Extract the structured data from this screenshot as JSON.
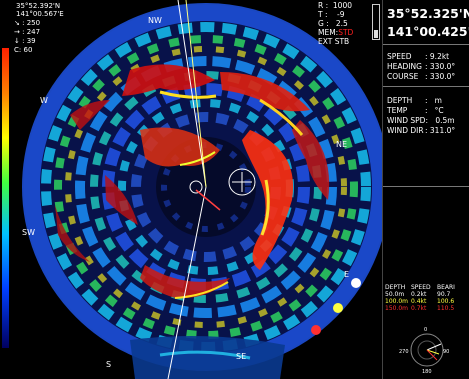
{
  "overlay": {
    "lat": "35°52.392'N",
    "lon": "141°00.567'E",
    "params": [
      {
        "icon": "↘",
        "value": "250"
      },
      {
        "icon": "→",
        "value": "247"
      },
      {
        "icon": "↓",
        "value": "39"
      },
      {
        "icon": "C:",
        "value": "60"
      }
    ],
    "settings": [
      {
        "label": "R :",
        "value": "1000"
      },
      {
        "label": "T :",
        "value": "-9"
      },
      {
        "label": "G :",
        "value": "2.5"
      },
      {
        "label": "MEM:",
        "value": "STD"
      },
      {
        "label": "EXT",
        "value": "STB"
      }
    ]
  },
  "compass": {
    "nw": "NW",
    "ne": "NE",
    "w": "W",
    "sw": "SW",
    "s": "S",
    "se": "SE",
    "e": "E"
  },
  "panel": {
    "lat": "35°52.325'N",
    "lon": "141°00.425'E",
    "nav": [
      {
        "label": "SPEED",
        "value": ": 9.2kt"
      },
      {
        "label": "HEADING",
        "value": ": 330.0°"
      },
      {
        "label": "COURSE",
        "value": ": 330.0°"
      }
    ],
    "env": [
      {
        "label": "DEPTH",
        "value": ":   m"
      },
      {
        "label": "TEMP",
        "value": ":   °C"
      },
      {
        "label": "WIND SPD:",
        "value": " 0.5m"
      },
      {
        "label": "WIND DIR",
        "value": ": 311.0°"
      }
    ],
    "current_headers": [
      "DEPTH",
      "SPEED",
      "BEARI"
    ],
    "current_rows": [
      {
        "depth": "50.0m",
        "speed": "0.2kt",
        "bearing": "90.7",
        "color": "#ffffff"
      },
      {
        "depth": "100.0m",
        "speed": "0.4kt",
        "bearing": "100.6",
        "color": "#ffff40"
      },
      {
        "depth": "150.0m",
        "speed": "0.7kt",
        "bearing": "110.5",
        "color": "#ff3030"
      }
    ],
    "mini_compass": {
      "n": "0",
      "e": "90",
      "s": "180",
      "w": "270"
    }
  },
  "colors": {
    "ring_white": "#ffffff",
    "ring_yellow": "#ffff40",
    "ring_red": "#ff3030",
    "mem_red": "#ff2020"
  }
}
